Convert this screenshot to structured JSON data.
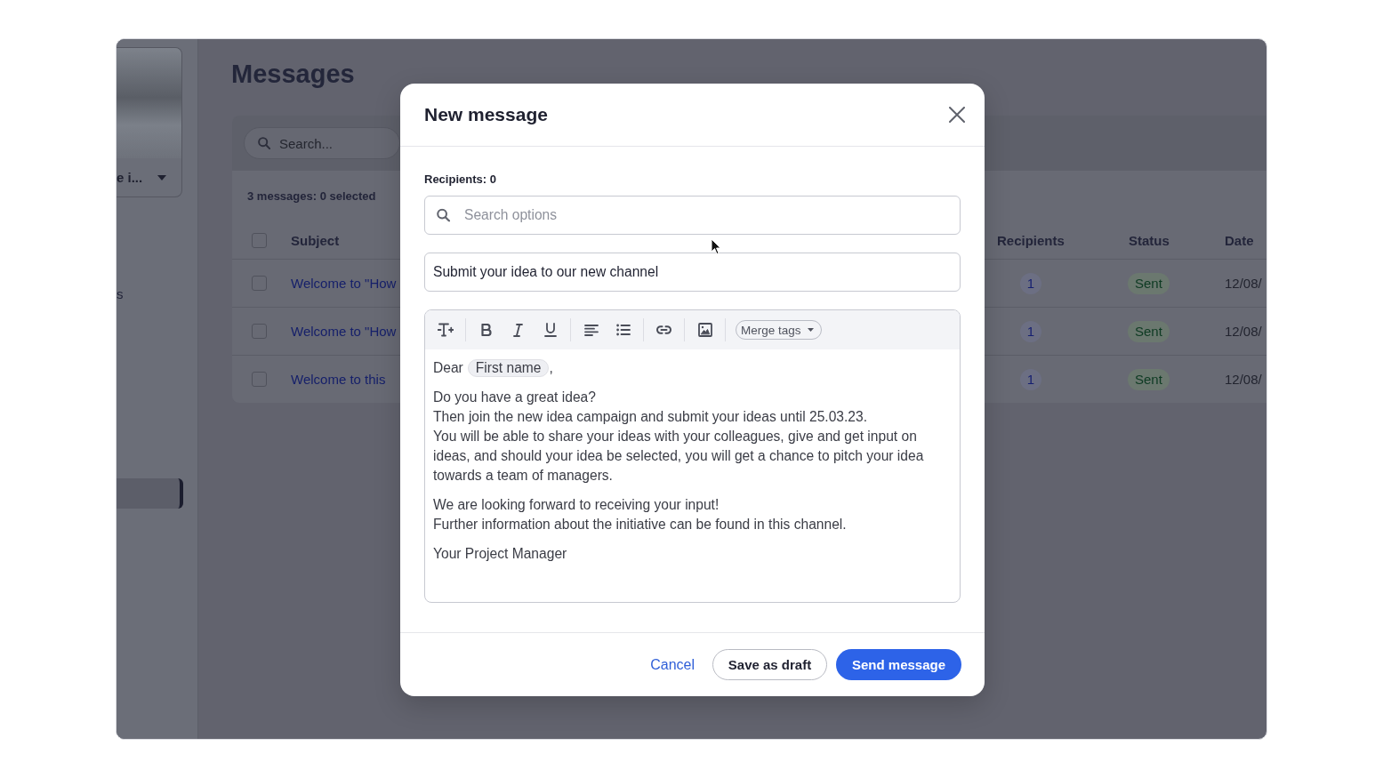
{
  "sidebar": {
    "account_menu": {
      "label": "e i..."
    },
    "items": [
      {
        "label": "s",
        "selected": false
      },
      {
        "selected": true
      }
    ]
  },
  "page": {
    "title": "Messages"
  },
  "messages_table": {
    "search": {
      "placeholder": "Search..."
    },
    "summary": "3 messages: 0 selected",
    "select_all": {
      "checked": false
    },
    "columns": [
      "Subject",
      "Recipients",
      "Status",
      "Date"
    ],
    "rows": [
      {
        "checked": false,
        "subject": "Welcome to \"How",
        "recipients": "1",
        "status": "Sent",
        "date": "12/08/"
      },
      {
        "checked": false,
        "subject": "Welcome to \"How",
        "recipients": "1",
        "status": "Sent",
        "date": "12/08/"
      },
      {
        "checked": false,
        "subject": "Welcome to this",
        "recipients": "1",
        "status": "Sent",
        "date": "12/08/"
      }
    ]
  },
  "dialog": {
    "title": "New message",
    "recipients_label": "Recipients: 0",
    "recipient_search": {
      "placeholder": "Search options"
    },
    "subject_field": {
      "value": "Submit your idea to our new channel"
    },
    "editor": {
      "merge_tags": "Merge tags",
      "greeting": "Dear",
      "merge_tag": "First name",
      "greeting_end": ",",
      "paragraphs": [
        [
          "Do you have a great idea?",
          "Then join the new idea campaign and submit your ideas until 25.03.23.",
          "You will be able to share your ideas with your colleagues, give and get input on ideas, and should your idea be selected, you will get a chance to pitch your idea towards a team of managers."
        ],
        [
          "We are looking forward to receiving your input!",
          "Further information about the initiative can be found in this channel."
        ],
        [
          "Your Project Manager"
        ]
      ]
    },
    "buttons": [
      {
        "label": "Cancel",
        "kind": "link"
      },
      {
        "label": "Save as draft",
        "kind": "secondary"
      },
      {
        "label": "Send message",
        "kind": "primary"
      }
    ]
  }
}
